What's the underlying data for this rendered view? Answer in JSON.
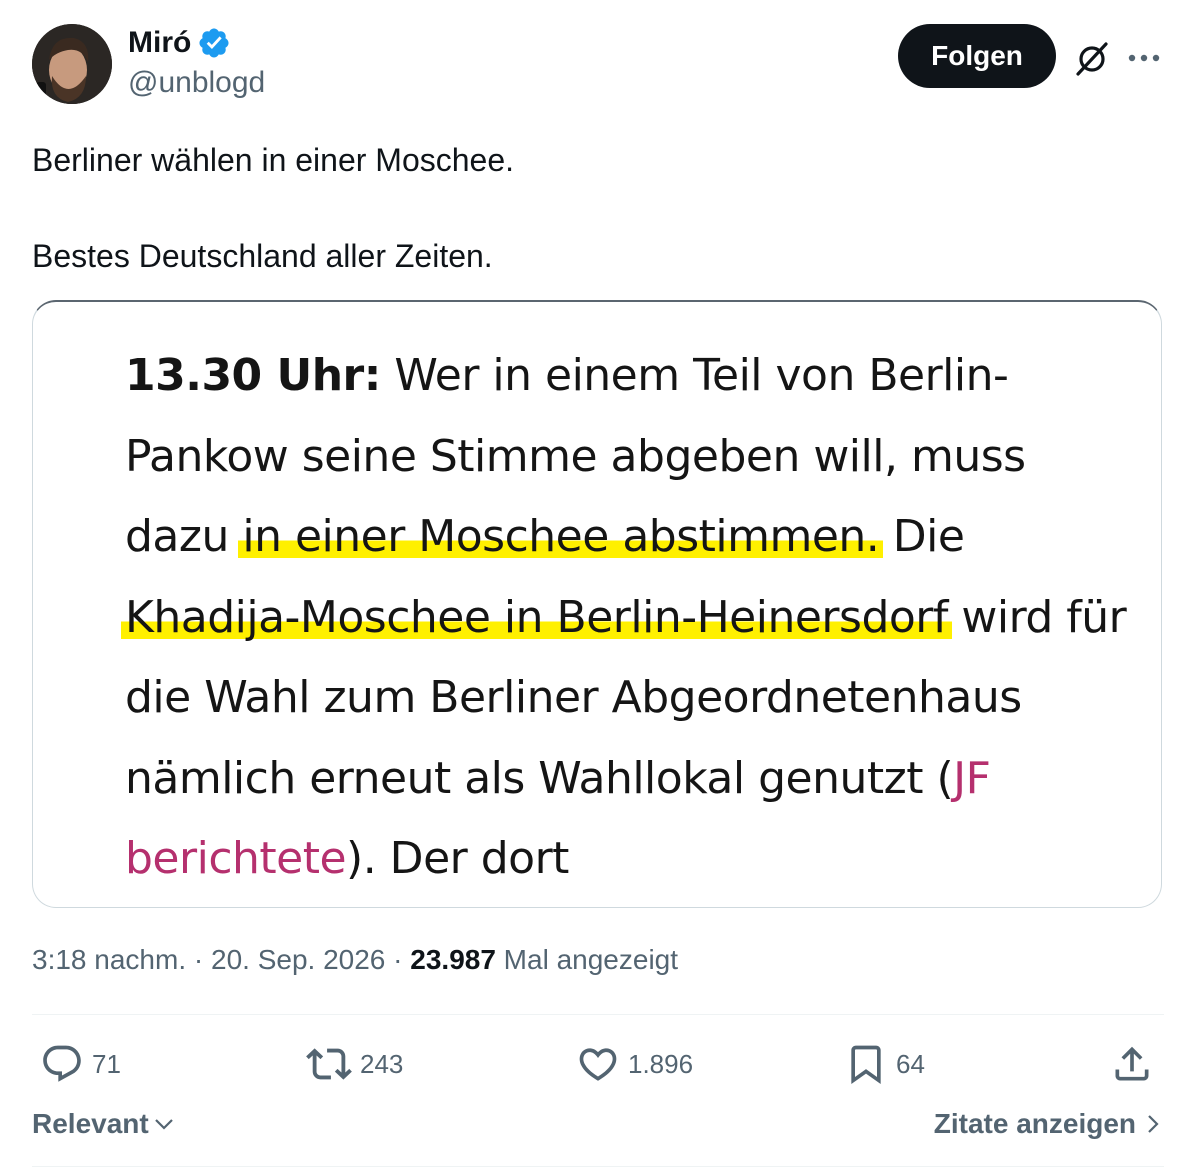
{
  "author": {
    "name": "Miró",
    "handle": "@unblogd",
    "verified": true
  },
  "header": {
    "follow_label": "Folgen",
    "grok_icon": "grok-icon",
    "more_icon": "more-dots-icon"
  },
  "tweet": {
    "line1": "Berliner wählen in einer Moschee.",
    "line2": "Bestes Deutschland aller Zeiten."
  },
  "media": {
    "time_label": "13.30 Uhr:",
    "part1": " Wer in einem Teil von Berlin-Pankow seine Stimme abgeben will, muss dazu ",
    "highlight1": "in einer Moschee abstimmen.",
    "part2": " Die ",
    "highlight2": "Khadija-Moschee in Berlin-Heinersdorf",
    "part3": " wird für die Wahl zum Berliner Abgeordnetenhaus nämlich erneut als Wahllokal genutzt (",
    "link_text": "JF berichtete",
    "part4": "). Der dort",
    "highlight_color": "#fff000",
    "link_color": "#b5306e"
  },
  "meta": {
    "time": "3:18 nachm.",
    "sep1": " · ",
    "date": "20. Sep. 2026",
    "sep2": " · ",
    "views_count": "23.987",
    "views_label": " Mal angezeigt"
  },
  "actions": {
    "reply_count": "71",
    "retweet_count": "243",
    "like_count": "1.896",
    "bookmark_count": "64"
  },
  "footer": {
    "sort_label": "Relevant",
    "quotes_label": "Zitate anzeigen"
  },
  "colors": {
    "text_primary": "#0f1419",
    "text_secondary": "#536471",
    "verified_blue": "#1d9bf0",
    "border": "#cfd9de"
  }
}
